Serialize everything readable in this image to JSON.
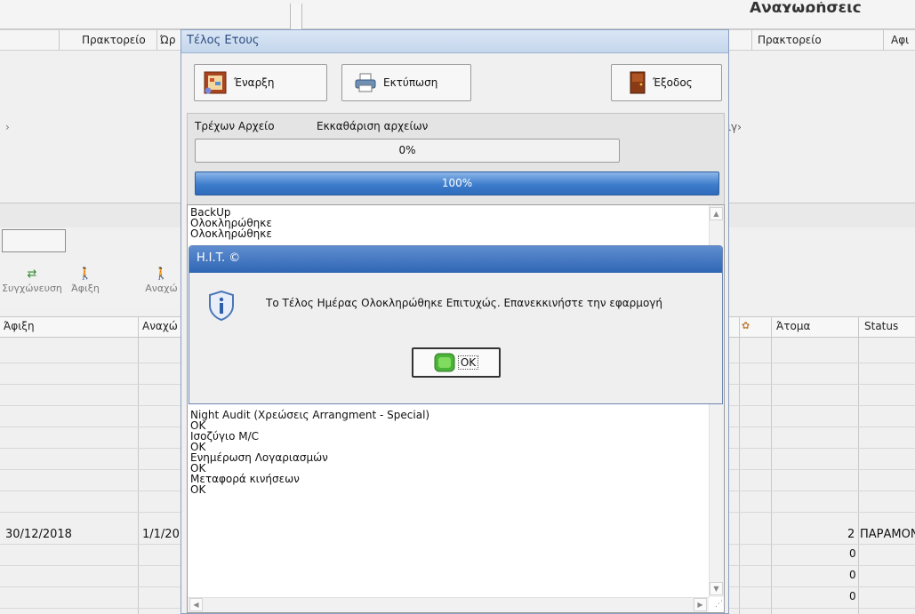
{
  "background": {
    "top_title": "Αναχωρήσεις",
    "left_col_prakt": "Πρακτορείο",
    "left_col_o": "Ώρ",
    "right_col_prakt": "Πρακτορείο",
    "right_col_af": "Αφι",
    "left_arrow": "›",
    "right_text": "ιγ›",
    "toolbar": {
      "sync": "Συγχώνευση",
      "arrival": "Άφιξη",
      "departure": "Αναχώ"
    },
    "table_headers": {
      "arrival": "Άφιξη",
      "departure": "Αναχώ",
      "persons": "Άτομα",
      "status": "Status"
    },
    "row": {
      "arrival": "30/12/2018",
      "departure": "1/1/20",
      "persons": "2",
      "status": "ΠΑΡΑΜΟΝ"
    },
    "zero_values": [
      "0",
      "0",
      "0"
    ]
  },
  "window": {
    "title": "Τέλος Ετους",
    "start_label": "Έναρξη",
    "print_label": "Εκτύπωση",
    "exit_label": "Έξοδος",
    "current_file_label": "Τρέχων Αρχείο",
    "cleanup_label": "Εκκαθάριση αρχείων",
    "progress_current": "0%",
    "progress_total": "100%",
    "log_top": [
      "BackUp",
      "Ολοκληρώθηκε",
      "Ολοκληρώθηκε"
    ],
    "log_bottom": [
      "Night Audit (Χρεώσεις Arrangment - Special)",
      "OK",
      "Ισοζύγιο M/C",
      "OK",
      "Ενημέρωση Λογαριασμών",
      "OK",
      "Μεταφορά κινήσεων",
      "OK"
    ]
  },
  "dialog": {
    "title": "H.I.T. ©",
    "message": "Το Τέλος Ημέρας Ολοκληρώθηκε Επιτυχώς. Επανεκκινήστε την εφαρμογή",
    "ok_label": "OK"
  },
  "colors": {
    "dialog_title": "#2f66b4",
    "progress": "#3d7dcc"
  }
}
